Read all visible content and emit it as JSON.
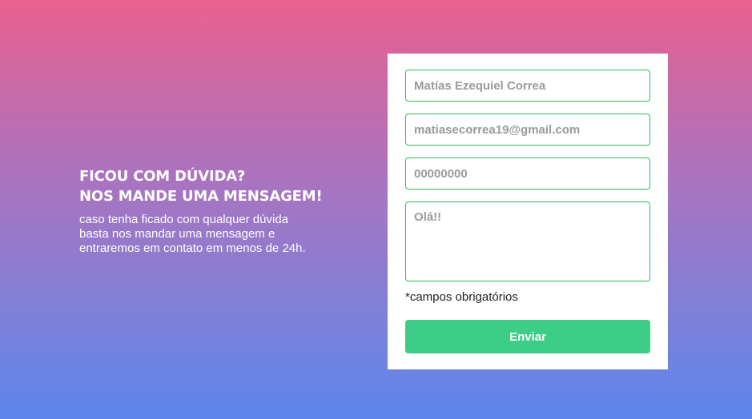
{
  "intro": {
    "title_line1": "FICOU COM DÚVIDA?",
    "title_line2": "NOS MANDE UMA MENSAGEM!",
    "description": "caso tenha ficado com qualquer dúvida basta nos mandar uma mensagem e entraremos em contato em menos de 24h."
  },
  "form": {
    "name": {
      "value": "",
      "placeholder": "Matías Ezequiel Correa"
    },
    "email": {
      "value": "",
      "placeholder": "matiasecorrea19@gmail.com"
    },
    "phone": {
      "value": "",
      "placeholder": "00000000"
    },
    "message": {
      "value": "",
      "placeholder": "Olá!!"
    },
    "required_note": "*campos obrigatórios",
    "submit_label": "Enviar"
  },
  "colors": {
    "gradient_top": "#e9618f",
    "gradient_bottom": "#5c86ed",
    "field_border": "#2dbb55",
    "button": "#3ccd87"
  }
}
